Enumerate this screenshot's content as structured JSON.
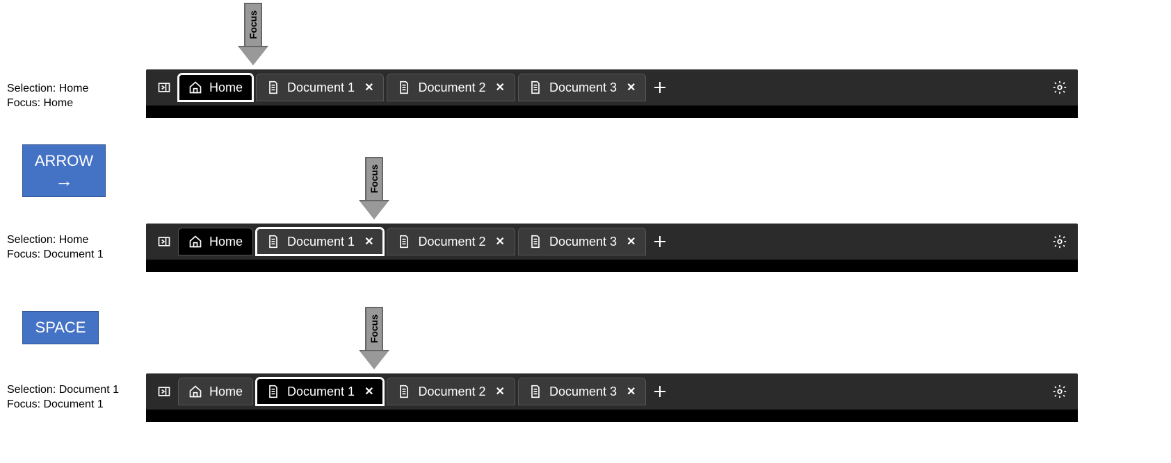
{
  "focus_pointer_label": "Focus",
  "keys": {
    "arrow": {
      "label": "ARROW",
      "glyph": "→"
    },
    "space": {
      "label": "SPACE"
    }
  },
  "states": [
    {
      "selection_label": "Selection: Home",
      "focus_label": "Focus: Home",
      "focused_tab_index": 0,
      "selected_tab_index": 0
    },
    {
      "selection_label": "Selection: Home",
      "focus_label": "Focus: Document 1",
      "focused_tab_index": 1,
      "selected_tab_index": 0
    },
    {
      "selection_label": "Selection: Document 1",
      "focus_label": "Focus: Document 1",
      "focused_tab_index": 1,
      "selected_tab_index": 1
    }
  ],
  "tabs": [
    {
      "label": "Home",
      "icon": "home",
      "closable": false
    },
    {
      "label": "Document 1",
      "icon": "document",
      "closable": true
    },
    {
      "label": "Document 2",
      "icon": "document",
      "closable": true
    },
    {
      "label": "Document 3",
      "icon": "document",
      "closable": true
    }
  ],
  "icons": {
    "close_glyph": "✕",
    "plus_glyph": "+"
  }
}
